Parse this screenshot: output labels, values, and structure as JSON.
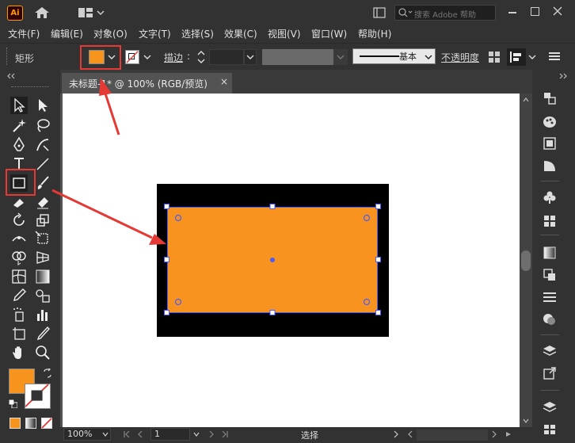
{
  "app": {
    "logo_text": "Ai",
    "search_placeholder": "搜索 Adobe 帮助"
  },
  "menu": {
    "items": [
      "文件(F)",
      "编辑(E)",
      "对象(O)",
      "文字(T)",
      "选择(S)",
      "效果(C)",
      "视图(V)",
      "窗口(W)",
      "帮助(H)"
    ]
  },
  "control_bar": {
    "tool_name": "矩形",
    "stroke_label": "描边",
    "stroke_style_label": "基本",
    "opacity_label": "不透明度",
    "fill_color": "#f7941d"
  },
  "document": {
    "tab_label": "未标题-1* @ 100% (RGB/预览)",
    "close_glyph": "×"
  },
  "canvas": {
    "rect_fill": "#f7931e",
    "background_rect_fill": "#000000",
    "selection_color": "#4a5cff"
  },
  "status": {
    "zoom": "100%",
    "page": "1",
    "tool_status": "选择"
  },
  "annotation": {
    "color": "#e53935"
  }
}
